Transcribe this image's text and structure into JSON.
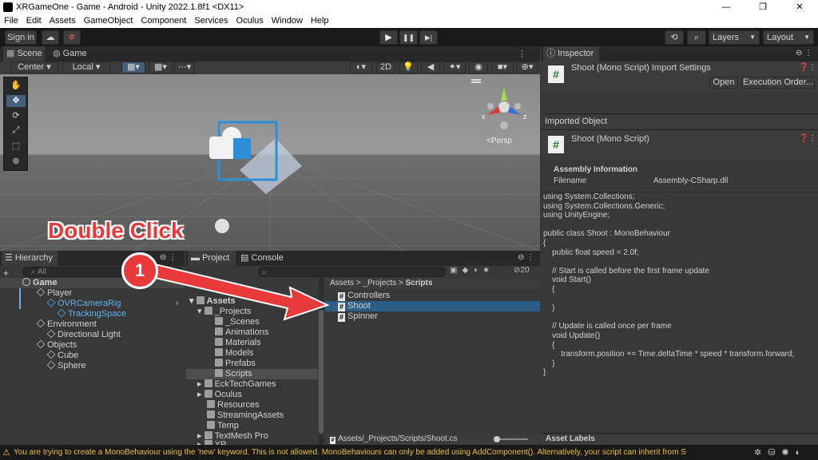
{
  "window": {
    "title": "XRGameOne - Game - Android - Unity 2022.1.8f1 <DX11>",
    "minimize": "—",
    "maximize": "❐",
    "close": "✕"
  },
  "menu": [
    "File",
    "Edit",
    "Assets",
    "GameObject",
    "Component",
    "Services",
    "Oculus",
    "Window",
    "Help"
  ],
  "toolbar": {
    "sign_in": "Sign in",
    "play": "▶",
    "pause": "❚❚",
    "step": "▶|",
    "layers": "Layers",
    "layout": "Layout"
  },
  "scene": {
    "tab_scene": "Scene",
    "tab_game": "Game",
    "pivot": "Center",
    "space": "Local",
    "mode_2d": "2D",
    "persp": "Persp",
    "gizmo_x": "x",
    "gizmo_z": "z"
  },
  "annotation": {
    "label": "Double Click",
    "step": "1"
  },
  "hierarchy": {
    "tab": "Hierarchy",
    "search_placeholder": "All",
    "add": "+",
    "items": [
      {
        "label": "Game"
      },
      {
        "label": "Player"
      },
      {
        "label": "OVRCameraRig"
      },
      {
        "label": "TrackingSpace"
      },
      {
        "label": "Environment"
      },
      {
        "label": "Directional Light"
      },
      {
        "label": "Objects"
      },
      {
        "label": "Cube"
      },
      {
        "label": "Sphere"
      }
    ]
  },
  "project": {
    "tab_project": "Project",
    "tab_console": "Console",
    "hidden_count": "20",
    "tree": [
      "Assets",
      "_Projects",
      "_Scenes",
      "Animations",
      "Materials",
      "Models",
      "Prefabs",
      "Scripts",
      "EckTechGames",
      "Oculus",
      "Resources",
      "StreamingAssets",
      "Temp",
      "TextMesh Pro",
      "XR"
    ],
    "breadcrumb": {
      "a": "Assets",
      "sep1": ">",
      "b": "_Projects",
      "sep2": ">",
      "c": "Scripts"
    },
    "files": [
      {
        "label": "Controllers"
      },
      {
        "label": "Shoot"
      },
      {
        "label": "Spinner"
      }
    ],
    "path": "Assets/_Projects/Scripts/Shoot.cs"
  },
  "inspector": {
    "tab": "Inspector",
    "title": "Shoot (Mono Script) Import Settings",
    "open": "Open",
    "execution_order": "Execution Order...",
    "imported_object": "Imported Object",
    "object_title": "Shoot (Mono Script)",
    "assembly_header": "Assembly Information",
    "filename_label": "Filename",
    "filename_value": "Assembly-CSharp.dll",
    "code": "using System.Collections;\nusing System.Collections.Generic;\nusing UnityEngine;\n\npublic class Shoot : MonoBehaviour\n{\n    public float speed = 2.0f;\n\n    // Start is called before the first frame update\n    void Start()\n    {\n\n    }\n\n    // Update is called once per frame\n    void Update()\n    {\n        transform.position += Time.deltaTime * speed * transform.forward;\n    }\n}",
    "asset_labels": "Asset Labels"
  },
  "status": {
    "message": "You are trying to create a MonoBehaviour using the 'new' keyword.  This is not allowed.  MonoBehaviours can only be added using AddComponent(). Alternatively, your script can inherit from S"
  }
}
